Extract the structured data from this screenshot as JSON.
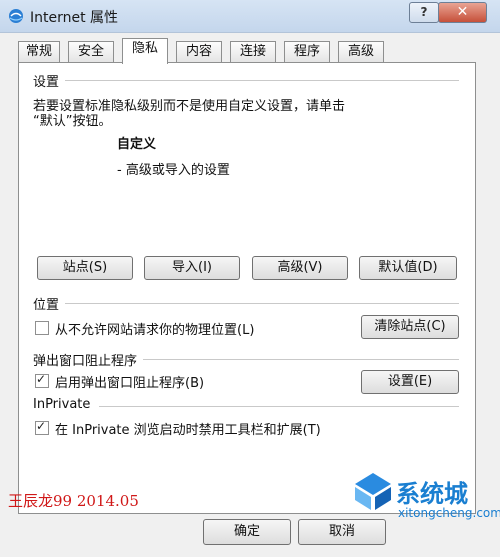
{
  "window": {
    "title": "Internet 属性",
    "help_label": "?",
    "close_label": "✕"
  },
  "tabs": [
    {
      "label": "常规"
    },
    {
      "label": "安全"
    },
    {
      "label": "隐私"
    },
    {
      "label": "内容"
    },
    {
      "label": "连接"
    },
    {
      "label": "程序"
    },
    {
      "label": "高级"
    }
  ],
  "settings": {
    "heading": "设置",
    "desc_line1": "若要设置标准隐私级别而不是使用自定义设置，请单击",
    "desc_line2": "“默认”按钮。",
    "level_title": "自定义",
    "level_detail": "- 高级或导入的设置",
    "buttons": {
      "sites": "站点(S)",
      "import": "导入(I)",
      "advanced": "高级(V)",
      "default": "默认值(D)"
    }
  },
  "location": {
    "heading": "位置",
    "checkbox_label": "从不允许网站请求你的物理位置(L)",
    "checked": false,
    "clear_button": "清除站点(C)"
  },
  "popup": {
    "heading": "弹出窗口阻止程序",
    "checkbox_label": "启用弹出窗口阻止程序(B)",
    "checked": true,
    "settings_button": "设置(E)"
  },
  "inprivate": {
    "heading": "InPrivate",
    "checkbox_label": "在 InPrivate 浏览启动时禁用工具栏和扩展(T)",
    "checked": true
  },
  "footer": {
    "ok_label": "确定",
    "cancel_label": "取消"
  },
  "watermark": {
    "text": "王辰龙99 2014.05"
  },
  "brand": {
    "name": "系统城",
    "site": "xitongcheng.com"
  },
  "colors": {
    "watermark": "#d01818",
    "brand": "#1a7fd1"
  }
}
